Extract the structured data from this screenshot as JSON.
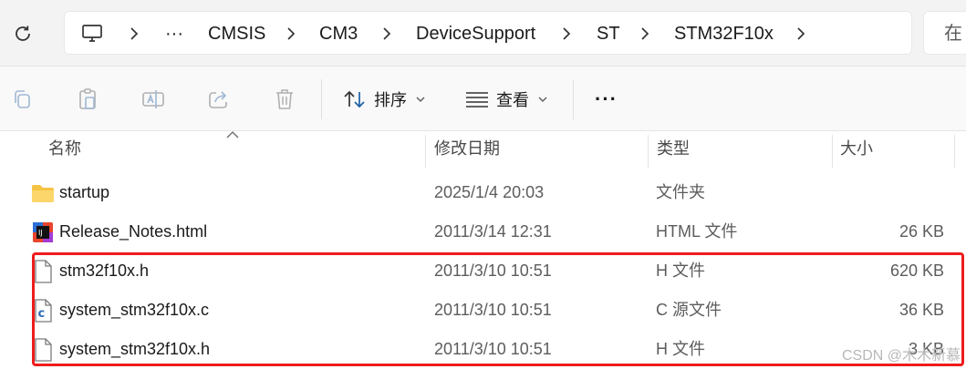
{
  "address_bar": {
    "overflow": "···",
    "crumbs": [
      "CMSIS",
      "CM3",
      "DeviceSupport",
      "ST",
      "STM32F10x"
    ],
    "search_placeholder": "在"
  },
  "toolbar": {
    "sort_label": "排序",
    "view_label": "查看",
    "more_label": "···"
  },
  "columns": {
    "name": "名称",
    "date": "修改日期",
    "type": "类型",
    "size": "大小"
  },
  "files": [
    {
      "name": "startup",
      "date": "2025/1/4 20:03",
      "type": "文件夹",
      "size": "",
      "icon": "folder-icon"
    },
    {
      "name": "Release_Notes.html",
      "date": "2011/3/14 12:31",
      "type": "HTML 文件",
      "size": "26 KB",
      "icon": "html-file-icon"
    },
    {
      "name": "stm32f10x.h",
      "date": "2011/3/10 10:51",
      "type": "H 文件",
      "size": "620 KB",
      "icon": "file-icon"
    },
    {
      "name": "system_stm32f10x.c",
      "date": "2011/3/10 10:51",
      "type": "C 源文件",
      "size": "36 KB",
      "icon": "c-file-icon"
    },
    {
      "name": "system_stm32f10x.h",
      "date": "2011/3/10 10:51",
      "type": "H 文件",
      "size": "3 KB",
      "icon": "file-icon"
    }
  ],
  "watermark": "CSDN @木木新慕",
  "colors": {
    "highlight": "#ee1c1c",
    "folder": "#f6c445",
    "c_icon": "#2f6db5"
  }
}
